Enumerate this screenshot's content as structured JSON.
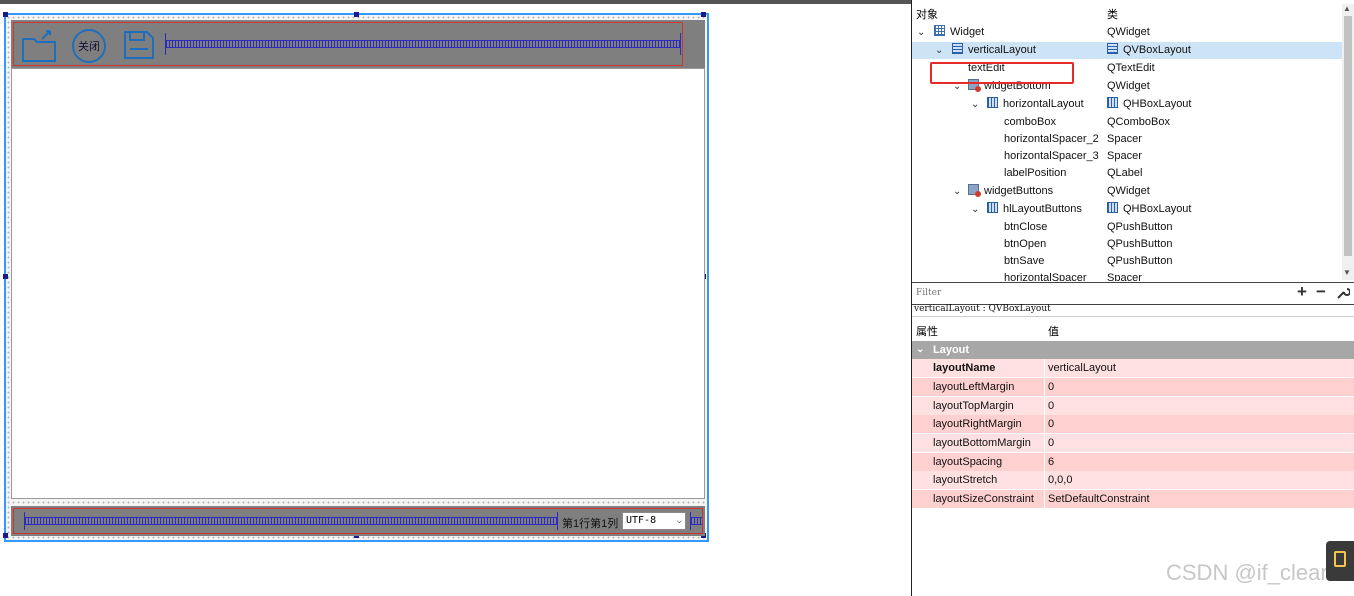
{
  "designer": {
    "close_button_label": "关闭",
    "status_label": "第1行第1列",
    "encoding_combo_value": "UTF-8"
  },
  "object_inspector": {
    "col_object": "对象",
    "col_class": "类",
    "rows": [
      {
        "name": "Widget",
        "class": "QWidget",
        "icon": "widget-grid-icon"
      },
      {
        "name": "verticalLayout",
        "class": "QVBoxLayout",
        "icon": "vbox-layout-icon",
        "class_icon": "vbox-layout-icon"
      },
      {
        "name": "textEdit",
        "class": "QTextEdit"
      },
      {
        "name": "widgetBottom",
        "class": "QWidget",
        "icon": "widget-icon"
      },
      {
        "name": "horizontalLayout",
        "class": "QHBoxLayout",
        "icon": "hbox-layout-icon",
        "class_icon": "hbox-layout-icon"
      },
      {
        "name": "comboBox",
        "class": "QComboBox"
      },
      {
        "name": "horizontalSpacer_2",
        "class": "Spacer"
      },
      {
        "name": "horizontalSpacer_3",
        "class": "Spacer"
      },
      {
        "name": "labelPosition",
        "class": "QLabel"
      },
      {
        "name": "widgetButtons",
        "class": "QWidget",
        "icon": "widget-icon"
      },
      {
        "name": "hlLayoutButtons",
        "class": "QHBoxLayout",
        "icon": "hbox-layout-icon",
        "class_icon": "hbox-layout-icon"
      },
      {
        "name": "btnClose",
        "class": "QPushButton"
      },
      {
        "name": "btnOpen",
        "class": "QPushButton"
      },
      {
        "name": "btnSave",
        "class": "QPushButton"
      },
      {
        "name": "horizontalSpacer",
        "class": "Spacer"
      }
    ],
    "selected": "verticalLayout"
  },
  "filter": {
    "placeholder": "Filter",
    "add_label": "+",
    "remove_label": "−"
  },
  "property_editor": {
    "caption": "verticalLayout : QVBoxLayout",
    "col_property": "属性",
    "col_value": "值",
    "group": "Layout",
    "rows": [
      {
        "name": "layoutName",
        "value": "verticalLayout"
      },
      {
        "name": "layoutLeftMargin",
        "value": "0"
      },
      {
        "name": "layoutTopMargin",
        "value": "0"
      },
      {
        "name": "layoutRightMargin",
        "value": "0"
      },
      {
        "name": "layoutBottomMargin",
        "value": "0"
      },
      {
        "name": "layoutSpacing",
        "value": "6"
      },
      {
        "name": "layoutStretch",
        "value": "0,0,0"
      },
      {
        "name": "layoutSizeConstraint",
        "value": "SetDefaultConstraint"
      }
    ]
  },
  "watermark": "CSDN @if_clear",
  "colors": {
    "selection_blue": "#3399ff",
    "highlight_row": "#cde4f7",
    "annotation_red": "#e52a2a",
    "prop_row_pink": "#ffd0d0"
  }
}
